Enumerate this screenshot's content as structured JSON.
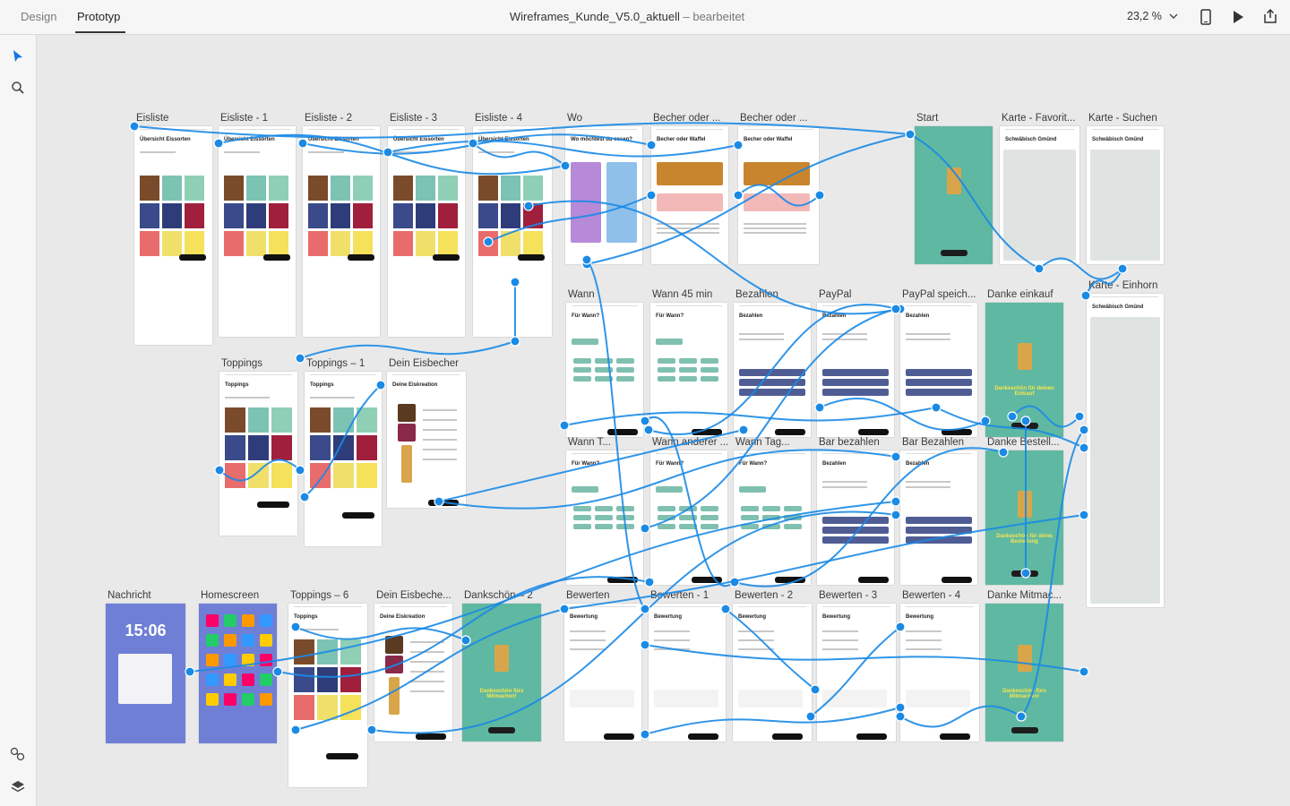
{
  "tabs": [
    {
      "label": "Design",
      "active": false
    },
    {
      "label": "Prototyp",
      "active": true
    }
  ],
  "document": {
    "name": "Wireframes_Kunde_V5.0_aktuell",
    "status": "– bearbeitet"
  },
  "zoom": {
    "value": "23,2 %"
  },
  "toolbar_icons": [
    "chevron-down-icon",
    "device-preview-icon",
    "play-icon",
    "share-icon"
  ],
  "left_tools": [
    "select-tool-icon",
    "zoom-tool-icon",
    "components-icon",
    "layers-icon"
  ],
  "colors": {
    "wire": "#1a8ae5",
    "teal": "#5fb8a2",
    "select": "#1473e6"
  },
  "artboards": [
    {
      "label": "Eisliste",
      "header": "Übersicht Eissorten",
      "kind": "ice"
    },
    {
      "label": "Eisliste - 1",
      "header": "Übersicht Eissorten",
      "kind": "ice"
    },
    {
      "label": "Eisliste - 2",
      "header": "Übersicht Eissorten",
      "kind": "ice"
    },
    {
      "label": "Eisliste - 3",
      "header": "Übersicht Eissorten",
      "kind": "ice"
    },
    {
      "label": "Eisliste - 4",
      "header": "Übersicht Eissorten",
      "kind": "ice"
    },
    {
      "label": "Wo",
      "header": "Wo möchtest du essen?",
      "kind": "wo"
    },
    {
      "label": "Becher oder ...",
      "header": "Becher oder Waffel",
      "kind": "becher"
    },
    {
      "label": "Becher oder ...",
      "header": "Becher oder Waffel",
      "kind": "becher"
    },
    {
      "label": "Start",
      "header": "",
      "kind": "teal"
    },
    {
      "label": "Karte - Favorit...",
      "header": "Schwäbisch Gmünd",
      "kind": "map"
    },
    {
      "label": "Karte - Suchen",
      "header": "Schwäbisch Gmünd",
      "kind": "map"
    },
    {
      "label": "Karte - Einhorn",
      "header": "Schwäbisch Gmünd",
      "kind": "map"
    },
    {
      "label": "Wann",
      "header": "Für Wann?",
      "kind": "wann"
    },
    {
      "label": "Wann 45 min",
      "header": "Für Wann?",
      "kind": "wann"
    },
    {
      "label": "Bezahlen",
      "header": "Bezahlen",
      "kind": "pay"
    },
    {
      "label": "PayPal",
      "header": "Bezahlen",
      "kind": "pay"
    },
    {
      "label": "PayPal speich...",
      "header": "Bezahlen",
      "kind": "pay"
    },
    {
      "label": "Danke einkauf",
      "header": "Dankeschön für deinen Einkauf",
      "kind": "teal"
    },
    {
      "label": "Toppings",
      "header": "Toppings",
      "kind": "top"
    },
    {
      "label": "Toppings – 1",
      "header": "Toppings",
      "kind": "top"
    },
    {
      "label": "Dein Eisbecher",
      "header": "Deine Eiskreation",
      "kind": "cone"
    },
    {
      "label": "Wann T...",
      "header": "Für Wann?",
      "kind": "wann"
    },
    {
      "label": "Wann anderer ...",
      "header": "Für Wann?",
      "kind": "wann"
    },
    {
      "label": "Wann Tag...",
      "header": "Für Wann?",
      "kind": "wann"
    },
    {
      "label": "Bar bezahlen",
      "header": "Bezahlen",
      "kind": "pay"
    },
    {
      "label": "Bar Bezahlen",
      "header": "Bezahlen",
      "kind": "pay"
    },
    {
      "label": "Danke Bestell...",
      "header": "Dankeschön für deine Bestellung",
      "kind": "teal"
    },
    {
      "label": "Nachricht",
      "header": "15:06",
      "kind": "lock"
    },
    {
      "label": "Homescreen",
      "header": "",
      "kind": "home"
    },
    {
      "label": "Toppings – 6",
      "header": "Toppings",
      "kind": "top"
    },
    {
      "label": "Dein Eisbeche...",
      "header": "Deine Eiskreation",
      "kind": "cone"
    },
    {
      "label": "Dankschön – 2",
      "header": "Dankeschön fürs Mitmachen!",
      "kind": "teal"
    },
    {
      "label": "Bewerten",
      "header": "Bewertung",
      "kind": "rate"
    },
    {
      "label": "Bewerten - 1",
      "header": "Bewertung",
      "kind": "rate"
    },
    {
      "label": "Bewerten - 2",
      "header": "Bewertung",
      "kind": "rate"
    },
    {
      "label": "Bewerten - 3",
      "header": "Bewertung",
      "kind": "rate"
    },
    {
      "label": "Bewerten - 4",
      "header": "Bewertung",
      "kind": "rate"
    },
    {
      "label": "Danke Mitmac...",
      "header": "Dankeschön fürs Mitmachen!",
      "kind": "teal"
    }
  ]
}
